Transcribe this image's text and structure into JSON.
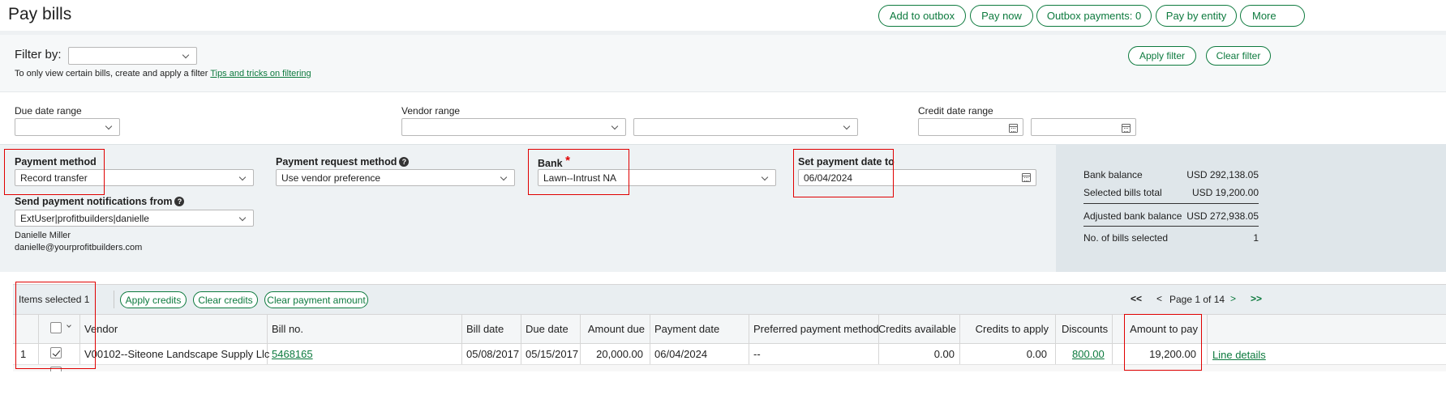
{
  "page": {
    "title": "Pay bills"
  },
  "header_actions": [
    {
      "label": "Add to outbox"
    },
    {
      "label": "Pay now"
    },
    {
      "label": "Outbox payments: 0"
    },
    {
      "label": "Pay by entity"
    },
    {
      "label": "More"
    }
  ],
  "filter": {
    "label": "Filter by:",
    "value": "",
    "hint": "To only view certain bills, create and apply a filter",
    "hint_link": "Tips and tricks on filtering",
    "apply_label": "Apply filter",
    "clear_label": "Clear filter"
  },
  "ranges": {
    "due_date_label": "Due date range",
    "vendor_label": "Vendor range",
    "credit_date_label": "Credit date range"
  },
  "payment": {
    "method_label": "Payment method",
    "method_value": "Record transfer",
    "request_method_label": "Payment request method",
    "request_method_value": "Use vendor preference",
    "bank_label": "Bank",
    "bank_required": "*",
    "bank_value": "Lawn--Intrust NA",
    "set_date_label": "Set payment date to",
    "set_date_value": "06/04/2024",
    "notify_label": "Send payment notifications from",
    "notify_value": "ExtUser|profitbuilders|danielle",
    "notify_name": "Danielle Miller",
    "notify_email": "danielle@yourprofitbuilders.com"
  },
  "balance": {
    "bank_balance_label": "Bank balance",
    "bank_balance_value": "USD 292,138.05",
    "selected_total_label": "Selected bills total",
    "selected_total_value": "USD 19,200.00",
    "adjusted_label": "Adjusted bank balance",
    "adjusted_value": "USD 272,938.05",
    "count_label": "No. of bills selected",
    "count_value": "1"
  },
  "toolbar": {
    "items_selected": "Items selected 1",
    "apply_credits": "Apply credits",
    "clear_credits": "Clear credits",
    "clear_payment_amount": "Clear payment amount",
    "first": "<<",
    "prev": "<",
    "page_text": "Page 1 of 14",
    "next": ">",
    "last": ">>"
  },
  "table": {
    "headers": {
      "vendor": "Vendor",
      "bill_no": "Bill no.",
      "bill_date": "Bill date",
      "due_date": "Due date",
      "amount_due": "Amount due",
      "payment_date": "Payment date",
      "preferred_method": "Preferred payment method",
      "credits_available": "Credits available",
      "credits_to_apply": "Credits to apply",
      "discounts": "Discounts",
      "amount_to_pay": "Amount to pay"
    },
    "rows": [
      {
        "num": "1",
        "checked": true,
        "vendor": "V00102--Siteone Landscape Supply Llc",
        "bill_no": "5468165",
        "bill_date": "05/08/2017",
        "due_date": "05/15/2017",
        "amount_due": "20,000.00",
        "payment_date": "06/04/2024",
        "preferred_method": "--",
        "credits_available": "0.00",
        "credits_to_apply": "0.00",
        "discounts": "800.00",
        "amount_to_pay": "19,200.00",
        "line_details": "Line details"
      }
    ]
  },
  "colors": {
    "accent": "#0d7a3e",
    "highlight": "#e00000",
    "panel": "#eef2f4"
  }
}
